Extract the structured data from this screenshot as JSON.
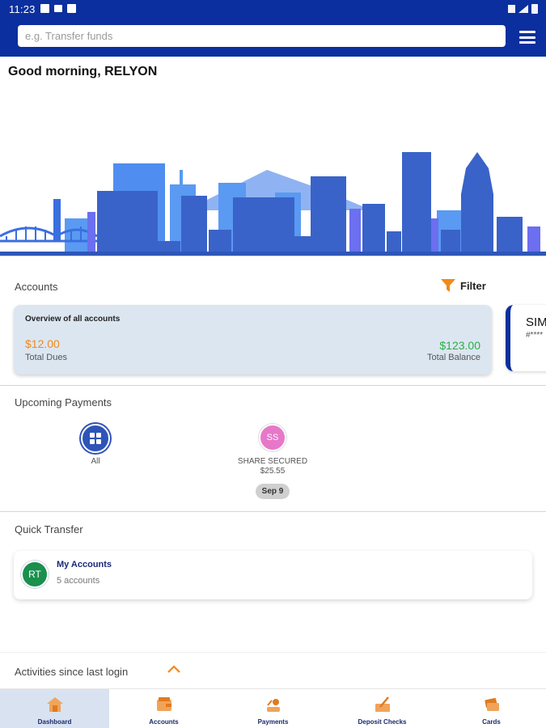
{
  "status_bar": {
    "time": "11:23"
  },
  "search": {
    "placeholder": "e.g. Transfer funds"
  },
  "greeting": "Good morning, RELYON",
  "accounts": {
    "title": "Accounts",
    "filter_label": "Filter",
    "overview": {
      "title": "Overview of all accounts",
      "total_dues_value": "$12.00",
      "total_dues_label": "Total Dues",
      "total_balance_value": "$123.00",
      "total_balance_label": "Total Balance"
    },
    "second_card": {
      "name": "SIM",
      "number": "#****"
    }
  },
  "upcoming_payments": {
    "title": "Upcoming Payments",
    "all_label": "All",
    "items": [
      {
        "initials": "SS",
        "name": "SHARE SECURED",
        "amount": "$25.55",
        "date": "Sep 9"
      }
    ]
  },
  "quick_transfer": {
    "title": "Quick Transfer",
    "avatar_initials": "RT",
    "card_title": "My Accounts",
    "card_subtitle": "5 accounts"
  },
  "activities": {
    "title": "Activities since last login"
  },
  "bottom_nav": [
    {
      "label": "Dashboard",
      "icon": "home-icon",
      "active": true
    },
    {
      "label": "Accounts",
      "icon": "wallet-icon",
      "active": false
    },
    {
      "label": "Payments",
      "icon": "payments-icon",
      "active": false
    },
    {
      "label": "Deposit Checks",
      "icon": "deposit-check-icon",
      "active": false
    },
    {
      "label": "Cards",
      "icon": "cards-icon",
      "active": false
    }
  ],
  "colors": {
    "header": "#0b2f9e",
    "accent_orange": "#f08a18",
    "balance_green": "#27b043",
    "overview_card_bg": "#dce6f1",
    "avatar_pink": "#e778c9",
    "avatar_green": "#1a8f4e"
  }
}
